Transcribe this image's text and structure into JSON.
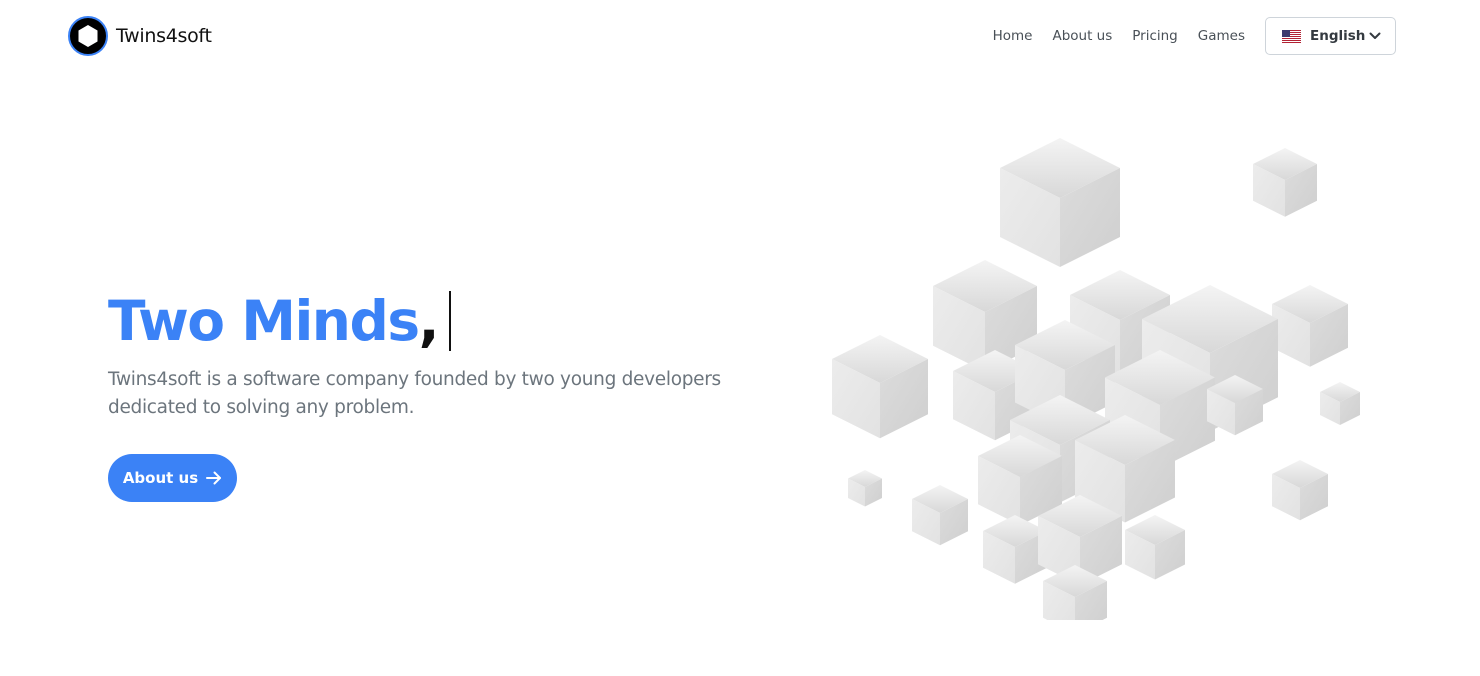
{
  "header": {
    "brand": "Twins4soft",
    "nav": [
      "Home",
      "About us",
      "Pricing",
      "Games"
    ],
    "language": {
      "selected": "English",
      "flag_icon": "us-flag-icon"
    }
  },
  "hero": {
    "title": "Two Minds",
    "title_punct": ",",
    "description": "Twins4soft is a software company founded by two young developers dedicated to solving any problem.",
    "cta_label": "About us"
  },
  "colors": {
    "accent": "#3b82f6",
    "text_dark": "#111111",
    "text_muted": "#6c757d",
    "nav_text": "#495057",
    "border": "#ced4da"
  },
  "icons": [
    "hexagon-logo-icon",
    "us-flag-icon",
    "chevron-down-icon",
    "arrow-right-icon"
  ]
}
